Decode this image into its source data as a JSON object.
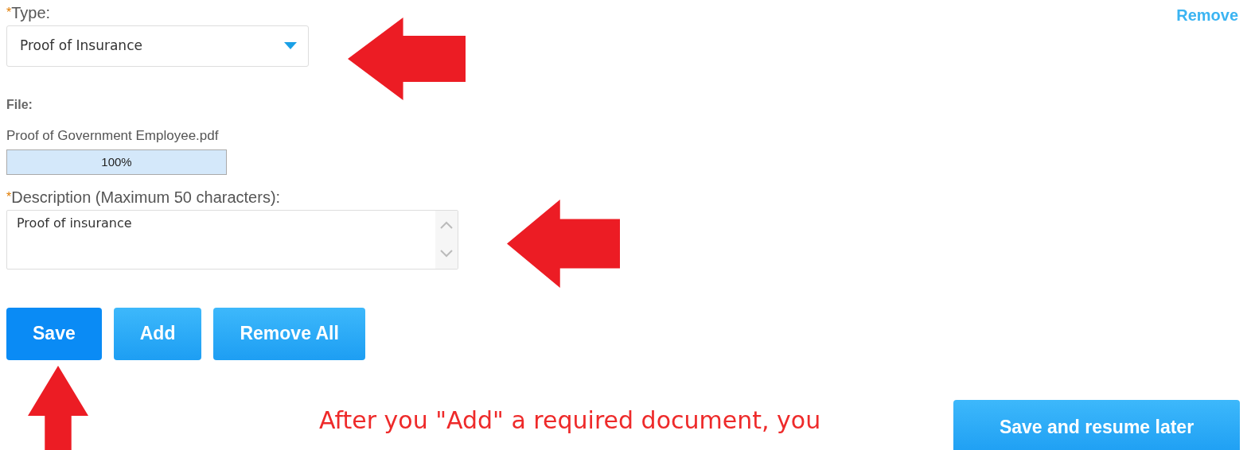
{
  "type_field": {
    "required_mark": "*",
    "label": "Type:",
    "value": "Proof of Insurance"
  },
  "remove_link": "Remove",
  "file": {
    "label": "File:",
    "name": "Proof of Government Employee.pdf",
    "level": 1.0,
    "reading": "100%"
  },
  "description_field": {
    "required_mark": "*",
    "label": "Description (Maximum 50 characters):",
    "value": "Proof of insurance"
  },
  "buttons": [
    {
      "label": "Save",
      "selected": true
    },
    {
      "label": "Add",
      "selected": false
    },
    {
      "label": "Remove All",
      "selected": false
    }
  ],
  "annotation": "After you \"Add\" a required document, you",
  "save_resume_button": "Save and resume later"
}
